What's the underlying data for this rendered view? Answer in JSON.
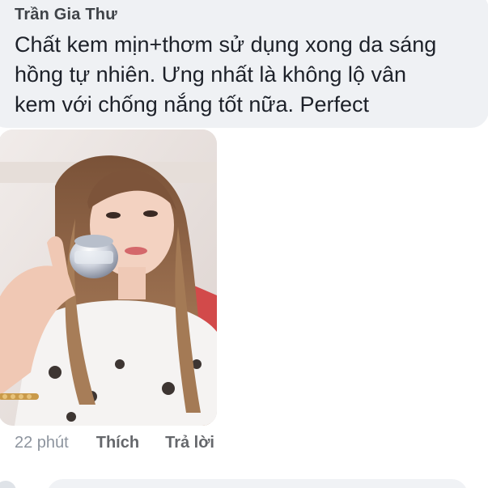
{
  "comment": {
    "author": "Trần Gia Thư",
    "text_lines": [
      "Chất kem mịn+thơm sử dụng xong da sáng",
      "hồng tự nhiên. Ưng nhất là không lộ vân",
      "kem với chống nắng tốt nữa. Perfect"
    ]
  },
  "actions": {
    "timestamp": "22 phút",
    "like_label": "Thích",
    "reply_label": "Trả lời"
  },
  "colors": {
    "bubble": "#eff1f4",
    "text": "#1d2129",
    "author": "#3f4348",
    "muted": "#8d949e"
  }
}
